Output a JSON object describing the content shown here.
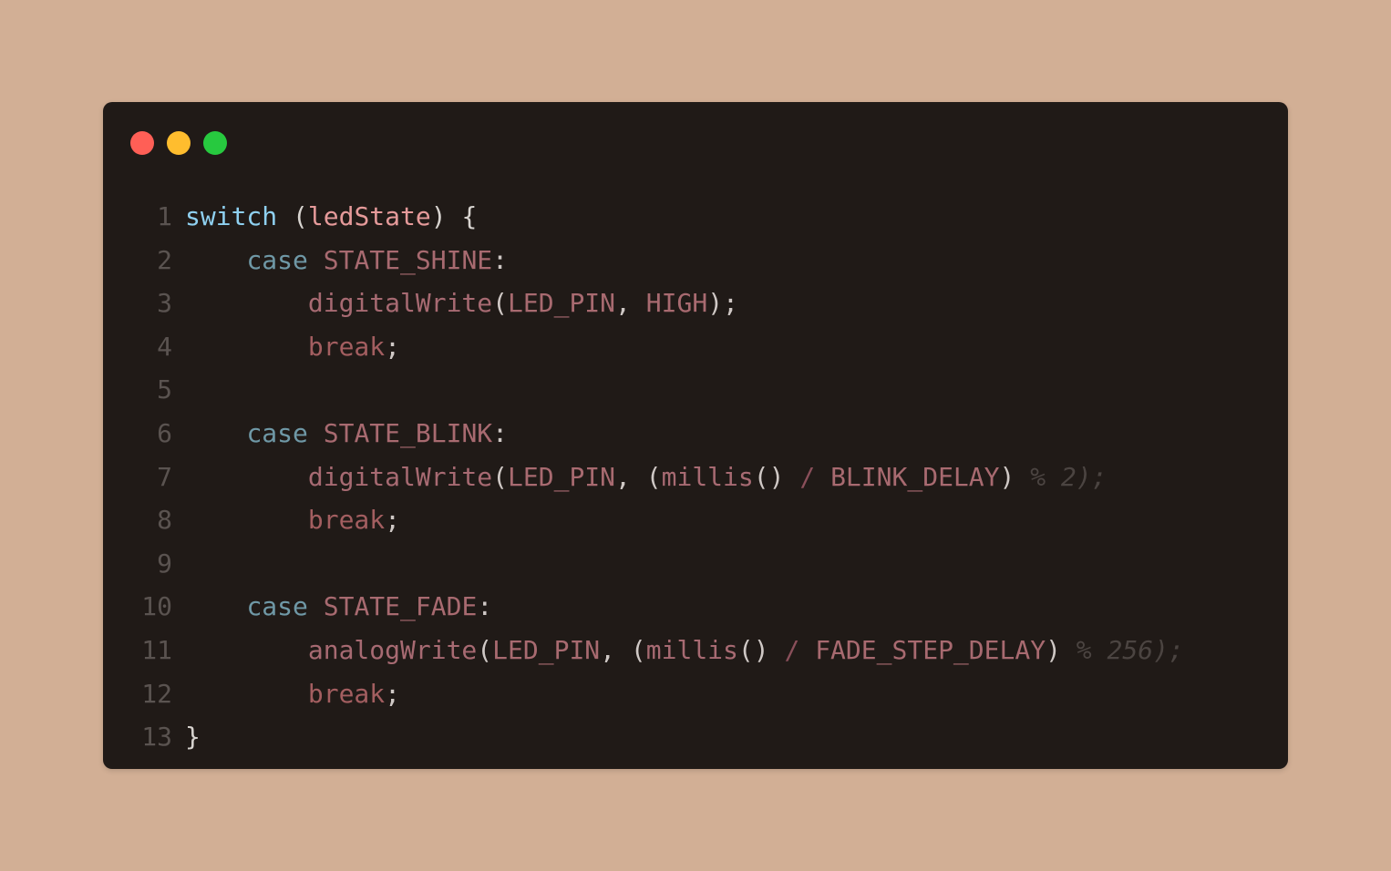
{
  "window": {
    "controls": {
      "close_color": "#ff5f56",
      "minimize_color": "#ffbd2e",
      "maximize_color": "#27c93f"
    }
  },
  "code": {
    "language": "C",
    "lines": [
      {
        "number": "1",
        "indent": "",
        "tokens": [
          [
            "kw-switch",
            "switch"
          ],
          [
            "paren",
            " ("
          ],
          [
            "ident",
            "ledState"
          ],
          [
            "paren",
            ") {"
          ]
        ]
      },
      {
        "number": "2",
        "indent": "    ",
        "tokens": [
          [
            "kw-case",
            "case"
          ],
          [
            "punct",
            " "
          ],
          [
            "const",
            "STATE_SHINE"
          ],
          [
            "punct",
            ":"
          ]
        ]
      },
      {
        "number": "3",
        "indent": "        ",
        "tokens": [
          [
            "fn",
            "digitalWrite"
          ],
          [
            "punct",
            "("
          ],
          [
            "const",
            "LED_PIN"
          ],
          [
            "punct",
            ", "
          ],
          [
            "const",
            "HIGH"
          ],
          [
            "punct",
            ");"
          ]
        ]
      },
      {
        "number": "4",
        "indent": "        ",
        "tokens": [
          [
            "kw-break",
            "break"
          ],
          [
            "punct",
            ";"
          ]
        ]
      },
      {
        "number": "5",
        "indent": "",
        "tokens": []
      },
      {
        "number": "6",
        "indent": "    ",
        "tokens": [
          [
            "kw-case",
            "case"
          ],
          [
            "punct",
            " "
          ],
          [
            "const",
            "STATE_BLINK"
          ],
          [
            "punct",
            ":"
          ]
        ]
      },
      {
        "number": "7",
        "indent": "        ",
        "tokens": [
          [
            "fn",
            "digitalWrite"
          ],
          [
            "punct",
            "("
          ],
          [
            "const",
            "LED_PIN"
          ],
          [
            "punct",
            ", ("
          ],
          [
            "fn",
            "millis"
          ],
          [
            "punct",
            "() "
          ],
          [
            "op",
            "/"
          ],
          [
            "punct",
            " "
          ],
          [
            "const",
            "BLINK_DELAY"
          ],
          [
            "punct",
            ") "
          ],
          [
            "tail",
            "% 2);"
          ]
        ]
      },
      {
        "number": "8",
        "indent": "        ",
        "tokens": [
          [
            "kw-break",
            "break"
          ],
          [
            "punct",
            ";"
          ]
        ]
      },
      {
        "number": "9",
        "indent": "",
        "tokens": []
      },
      {
        "number": "10",
        "indent": "    ",
        "tokens": [
          [
            "kw-case",
            "case"
          ],
          [
            "punct",
            " "
          ],
          [
            "const",
            "STATE_FADE"
          ],
          [
            "punct",
            ":"
          ]
        ]
      },
      {
        "number": "11",
        "indent": "        ",
        "tokens": [
          [
            "fn",
            "analogWrite"
          ],
          [
            "punct",
            "("
          ],
          [
            "const",
            "LED_PIN"
          ],
          [
            "punct",
            ", ("
          ],
          [
            "fn",
            "millis"
          ],
          [
            "punct",
            "() "
          ],
          [
            "op",
            "/"
          ],
          [
            "punct",
            " "
          ],
          [
            "const",
            "FADE_STEP_DELAY"
          ],
          [
            "punct",
            ") "
          ],
          [
            "tail",
            "% 256);"
          ]
        ]
      },
      {
        "number": "12",
        "indent": "        ",
        "tokens": [
          [
            "kw-break",
            "break"
          ],
          [
            "punct",
            ";"
          ]
        ]
      },
      {
        "number": "13",
        "indent": "",
        "tokens": [
          [
            "paren",
            "}"
          ]
        ]
      }
    ]
  }
}
